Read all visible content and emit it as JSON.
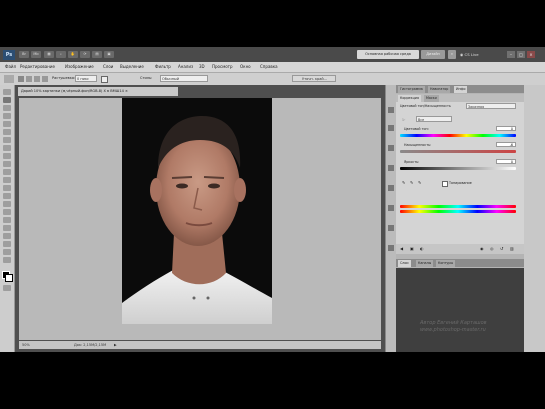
{
  "titlebar": {
    "logo": "Ps",
    "workspace_btn1": "Основная рабочая среда",
    "workspace_btn2": "Дизайн",
    "live": "CS Live"
  },
  "menubar": {
    "items": [
      "Файл",
      "Редактирование",
      "Изображение",
      "Слои",
      "Выделение",
      "Фильтр",
      "Анализ",
      "3D",
      "Просмотр",
      "Окно",
      "Справка"
    ]
  },
  "options": {
    "feather_label": "Растушевка:",
    "feather_value": "0 пикс",
    "style_label": "Стиль:",
    "style_value": "Обычный",
    "refine_label": "Уточн. край..."
  },
  "document": {
    "tab_title": "Дарий 10% картинки (м,чёрный-фон/RGB-8) X в ВМШ14",
    "zoom": "50%",
    "doc_size": "Док: 2,15M/2,15M"
  },
  "panels": {
    "top_tabs": [
      "Гистограмма",
      "Навигатор",
      "Инфо"
    ],
    "adj_tabs": [
      "Коррекция",
      "Маски"
    ],
    "adj_title": "Цветовой тон/Насыщенность",
    "preset": "Заказная",
    "channel": "Все",
    "hue_label": "Цветовой тон:",
    "hue_value": "0",
    "sat_label": "Насыщенность:",
    "sat_value": "-6",
    "light_label": "Яркость:",
    "light_value": "0",
    "colorize_label": "Тонирование",
    "bottom_tabs": [
      "Слои",
      "Каналы",
      "Контуры"
    ]
  },
  "watermark": {
    "line1": "Автор Евгений Карташов",
    "line2": "www.photoshop-master.ru"
  }
}
